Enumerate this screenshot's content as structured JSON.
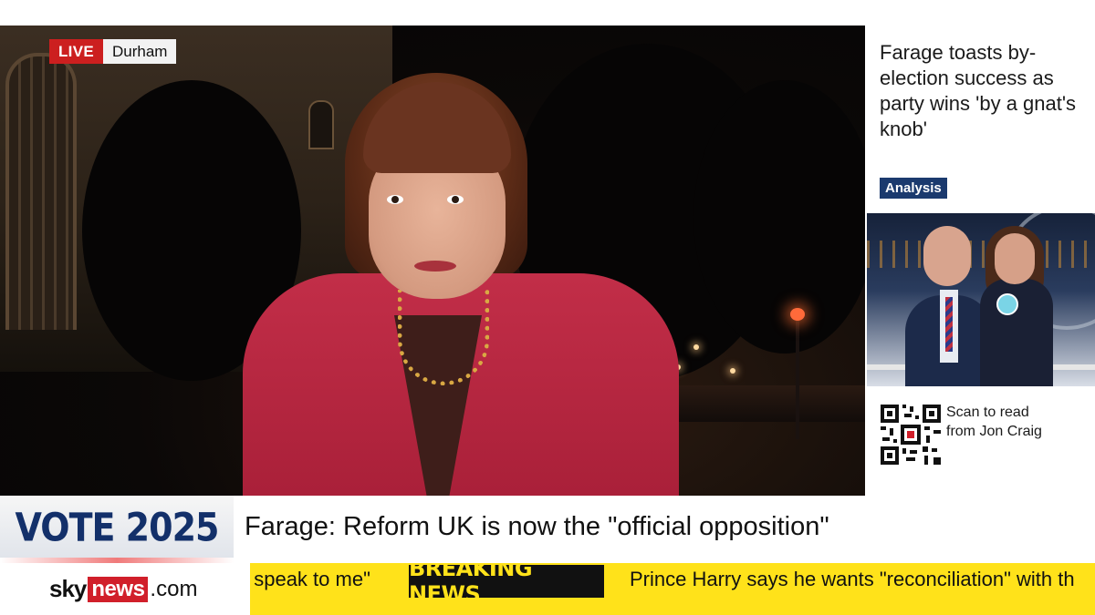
{
  "live_badge": {
    "live_label": "LIVE",
    "location": "Durham"
  },
  "side_panel": {
    "headline": "Farage toasts by-election success as party wins 'by a gnat's knob'",
    "tag": "Analysis",
    "scan_text": "Scan to read from Jon Craig"
  },
  "lower_third": {
    "vote_label": "VOTE 2025",
    "headline": "Farage: Reform UK is now the \"official opposition\""
  },
  "ticker": {
    "logo_sky": "sky",
    "logo_news": "news",
    "logo_dotcom": ".com",
    "prev_item": "t speak to me\"",
    "breaking_label": "BREAKING NEWS",
    "next_item": "Prince Harry says he wants \"reconciliation\" with th"
  },
  "colors": {
    "live_red": "#cc1f1f",
    "analysis_blue": "#1b3a6e",
    "vote_navy": "#13306a",
    "ticker_yellow": "#ffe21a",
    "sky_red": "#d11f2a"
  }
}
